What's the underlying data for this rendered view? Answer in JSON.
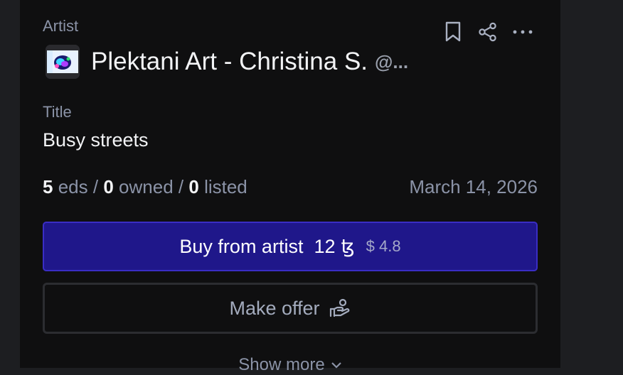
{
  "artist": {
    "label": "Artist",
    "name": "Plektani Art - Christina S.",
    "handle": "@..."
  },
  "title": {
    "label": "Title",
    "value": "Busy streets"
  },
  "stats": {
    "editions": "5",
    "editions_label": "eds",
    "separator": "/",
    "owned": "0",
    "owned_label": "owned",
    "listed": "0",
    "listed_label": "listed"
  },
  "date": "March 14, 2026",
  "buy": {
    "label": "Buy from artist",
    "price": "12",
    "currency_symbol": "ꜩ",
    "fiat": "$ 4.8"
  },
  "offer": {
    "label": "Make offer"
  },
  "show_more": {
    "label": "Show more"
  },
  "icons": {
    "bookmark": "bookmark-icon",
    "share": "share-icon",
    "more": "more-options-icon",
    "offer": "hand-offer-icon",
    "chevron": "chevron-down-icon"
  },
  "colors": {
    "panel_bg": "#0f0f10",
    "page_bg": "#1d1e21",
    "buy_bg": "#1f178a",
    "buy_border": "#3a2dc4",
    "muted_text": "#8b93a7"
  }
}
